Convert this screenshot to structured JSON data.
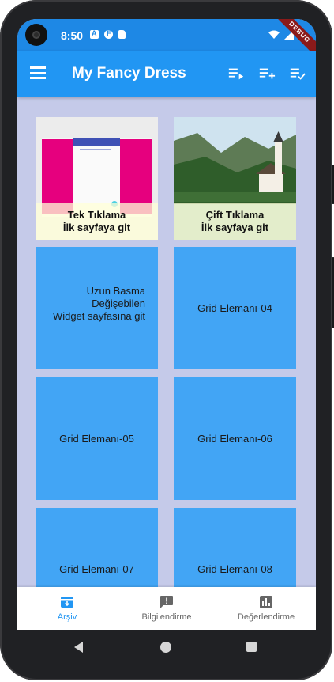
{
  "status_bar": {
    "time": "8:50",
    "left_icons": [
      "a-badge-icon",
      "f-badge-icon",
      "sd-card-icon"
    ],
    "right_icons": [
      "wifi-icon",
      "signal-icon",
      "battery-icon"
    ],
    "debug_banner": "DEBUG"
  },
  "app_bar": {
    "title": "My Fancy Dress",
    "menu_icon": "hamburger-menu-icon",
    "actions": [
      "playlist-play-icon",
      "playlist-add-icon",
      "playlist-check-icon"
    ]
  },
  "grid": {
    "tiles": [
      {
        "type": "image",
        "image": "app-screenshot",
        "line1": "Tek Tıklama",
        "line2": "İlk sayfaya git"
      },
      {
        "type": "image",
        "image": "lake-church",
        "line1": "Çift Tıklama",
        "line2": "İlk sayfaya git"
      },
      {
        "type": "text",
        "line1": "Uzun Basma",
        "line2": "Değişebilen",
        "line3": "Widget sayfasına git"
      },
      {
        "type": "text",
        "label": "Grid Elemanı-04"
      },
      {
        "type": "text",
        "label": "Grid Elemanı-05"
      },
      {
        "type": "text",
        "label": "Grid Elemanı-06"
      },
      {
        "type": "text",
        "label": "Grid Elemanı-07"
      },
      {
        "type": "text",
        "label": "Grid Elemanı-08"
      }
    ]
  },
  "bottom_nav": {
    "items": [
      {
        "label": "Arşiv",
        "icon": "archive-icon",
        "active": true
      },
      {
        "label": "Bilgilendirme",
        "icon": "feedback-icon",
        "active": false
      },
      {
        "label": "Değerlendirme",
        "icon": "bar-chart-icon",
        "active": false
      }
    ]
  },
  "colors": {
    "status_bar": "#1e88e5",
    "app_bar": "#2196f3",
    "tile": "#42a5f5",
    "background": "#c5cae9",
    "active_nav": "#2196f3"
  }
}
